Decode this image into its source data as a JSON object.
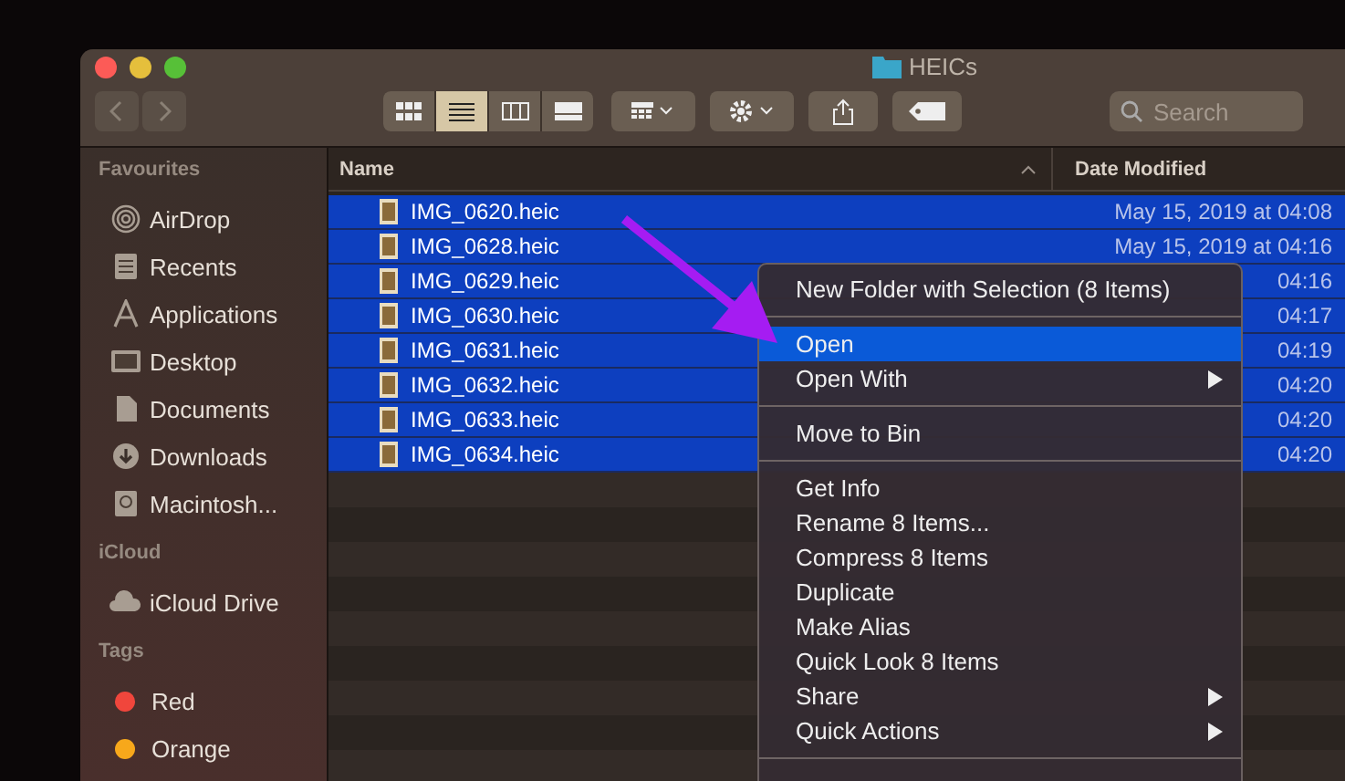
{
  "window": {
    "title": "HEICs"
  },
  "toolbar": {
    "view_modes": [
      {
        "kind": "icons",
        "selected": false
      },
      {
        "kind": "list",
        "selected": true
      },
      {
        "kind": "columns",
        "selected": false
      },
      {
        "kind": "gallery",
        "selected": false
      }
    ],
    "search": {
      "placeholder": "Search"
    }
  },
  "sidebar": {
    "sections": [
      {
        "title": "Favourites",
        "items": [
          {
            "kind": "airdrop",
            "label": "AirDrop"
          },
          {
            "kind": "recents",
            "label": "Recents"
          },
          {
            "kind": "applications",
            "label": "Applications"
          },
          {
            "kind": "desktop",
            "label": "Desktop"
          },
          {
            "kind": "documents",
            "label": "Documents"
          },
          {
            "kind": "downloads",
            "label": "Downloads"
          },
          {
            "kind": "disk",
            "label": "Macintosh..."
          }
        ]
      },
      {
        "title": "iCloud",
        "items": [
          {
            "kind": "cloud",
            "label": "iCloud Drive"
          }
        ]
      },
      {
        "title": "Tags",
        "items": [
          {
            "kind": "tag",
            "label": "Red",
            "color": "#f0463c"
          },
          {
            "kind": "tag",
            "label": "Orange",
            "color": "#f7a81b"
          }
        ]
      }
    ]
  },
  "table": {
    "columns": [
      "Name",
      "Date Modified"
    ],
    "rows": [
      {
        "name": "IMG_0620.heic",
        "date": "May 15, 2019 at 04:08",
        "selected": true
      },
      {
        "name": "IMG_0628.heic",
        "date": "May 15, 2019 at 04:16",
        "selected": true
      },
      {
        "name": "IMG_0629.heic",
        "date": "04:16",
        "selected": true
      },
      {
        "name": "IMG_0630.heic",
        "date": "04:17",
        "selected": true
      },
      {
        "name": "IMG_0631.heic",
        "date": "04:19",
        "selected": true
      },
      {
        "name": "IMG_0632.heic",
        "date": "04:20",
        "selected": true
      },
      {
        "name": "IMG_0633.heic",
        "date": "04:20",
        "selected": true
      },
      {
        "name": "IMG_0634.heic",
        "date": "04:20",
        "selected": true
      }
    ]
  },
  "context_menu": {
    "groups": [
      [
        {
          "label": "New Folder with Selection (8 Items)",
          "selected": false,
          "submenu": false
        }
      ],
      [
        {
          "label": "Open",
          "selected": true,
          "submenu": false
        },
        {
          "label": "Open With",
          "selected": false,
          "submenu": true
        }
      ],
      [
        {
          "label": "Move to Bin",
          "selected": false,
          "submenu": false
        }
      ],
      [
        {
          "label": "Get Info",
          "selected": false,
          "submenu": false
        },
        {
          "label": "Rename 8 Items...",
          "selected": false,
          "submenu": false
        },
        {
          "label": "Compress 8 Items",
          "selected": false,
          "submenu": false
        },
        {
          "label": "Duplicate",
          "selected": false,
          "submenu": false
        },
        {
          "label": "Make Alias",
          "selected": false,
          "submenu": false
        },
        {
          "label": "Quick Look 8 Items",
          "selected": false,
          "submenu": false
        },
        {
          "label": "Share",
          "selected": false,
          "submenu": true
        },
        {
          "label": "Quick Actions",
          "selected": false,
          "submenu": true
        }
      ]
    ]
  }
}
